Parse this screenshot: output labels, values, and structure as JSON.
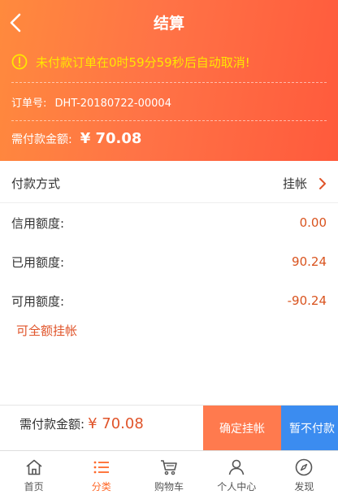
{
  "header": {
    "title": "结算",
    "notice": "未付款订单在0时59分59秒后自动取消!",
    "order_label": "订单号:",
    "order_no": "DHT-20180722-00004",
    "amount_label": "需付款金额:",
    "amount_value": "¥ 70.08"
  },
  "payment": {
    "method_label": "付款方式",
    "method_value": "挂帐",
    "credit_label": "信用额度:",
    "credit_value": "0.00",
    "used_label": "已用额度:",
    "used_value": "90.24",
    "available_label": "可用额度:",
    "available_value": "-90.24",
    "full_link": "可全额挂帐"
  },
  "actionbar": {
    "total_label": "需付款金额:",
    "total_value": "¥ 70.08",
    "confirm_label": "确定挂帐",
    "later_label": "暂不付款"
  },
  "tabs": [
    {
      "label": "首页",
      "icon": "home-icon"
    },
    {
      "label": "分类",
      "icon": "list-icon"
    },
    {
      "label": "购物车",
      "icon": "cart-icon"
    },
    {
      "label": "个人中心",
      "icon": "user-icon"
    },
    {
      "label": "发现",
      "icon": "compass-icon"
    }
  ],
  "colors": {
    "accent": "#ff6a2b",
    "notice": "#ffe700",
    "confirm": "#ff7a4e",
    "later": "#3b8cf0"
  }
}
